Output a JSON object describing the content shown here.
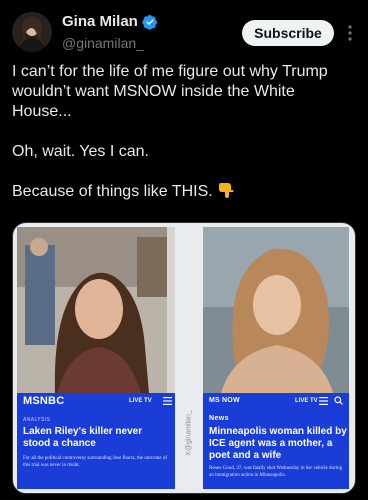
{
  "author": {
    "display_name": "Gina Milan",
    "handle": "@ginamilan_",
    "verified": true
  },
  "actions": {
    "subscribe_label": "Subscribe"
  },
  "tweet": {
    "paragraphs": [
      "I can’t for the life of me figure out why Trump wouldn’t want MSNOW inside the White House...",
      "Oh, wait. Yes I can.",
      "Because of things like THIS."
    ],
    "emoji": "pointing-down-hand"
  },
  "media": {
    "watermark": "X@ginamilan_",
    "left_card": {
      "logo": "MSNBC",
      "live_label": "LIVE TV",
      "kicker": "ANALYSIS",
      "headline": "Laken Riley's killer never stood a chance",
      "dek": "For all the political controversy surrounding Jose Ibarra, the outcome of this trial was never in doubt."
    },
    "right_card": {
      "logo": "MS NOW",
      "live_label": "LIVE TV",
      "kicker": "News",
      "headline": "Minneapolis woman killed by ICE agent was a mother, a poet and a wife",
      "dek": "Renee Good, 37, was fatally shot Wednesday in her vehicle during an immigration action in Minneapolis."
    }
  },
  "colors": {
    "background": "#000000",
    "text": "#e7e9ea",
    "muted": "#71767b",
    "verified": "#1d9bf0",
    "news_blue": "#1a3dd8"
  }
}
